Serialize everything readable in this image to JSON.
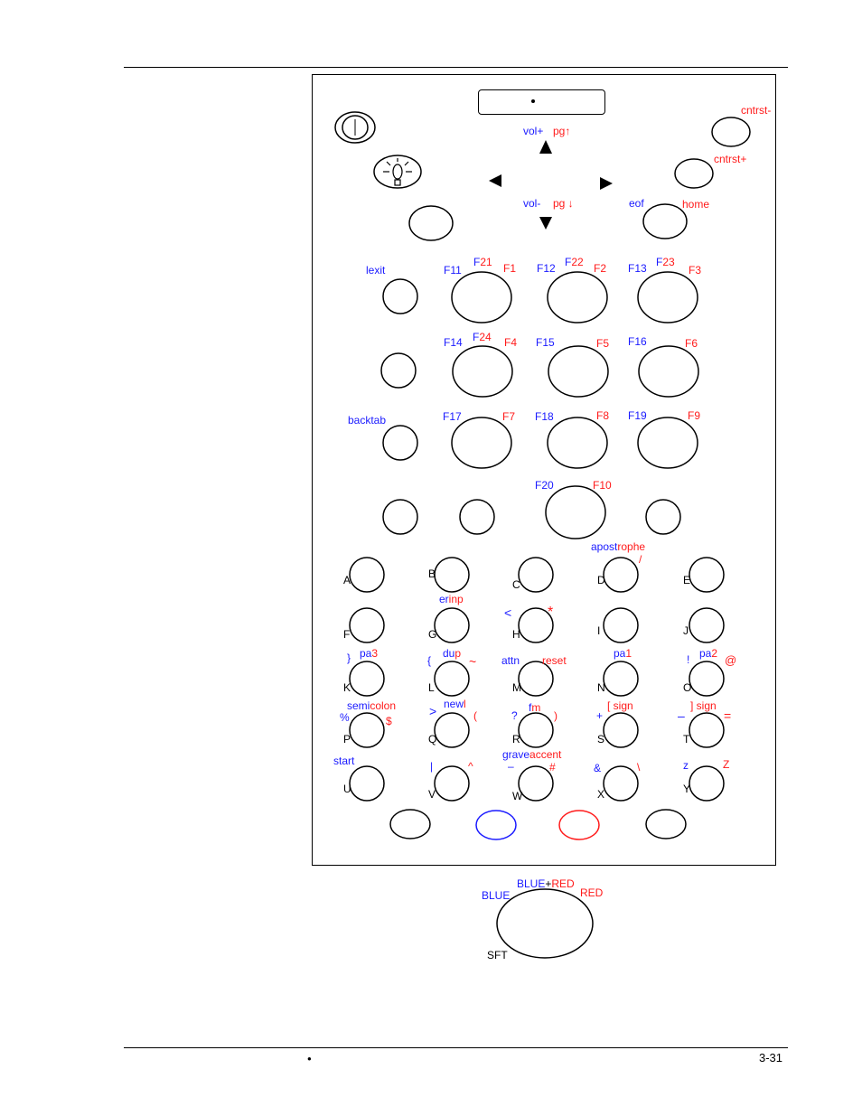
{
  "page": {
    "page_number": "3-31",
    "footer_bullet": "•"
  },
  "keypad": {
    "top": {
      "display_dot": "•",
      "power_icon": "power-icon",
      "backlight_icon": "backlight-icon",
      "vol_up": "vol+",
      "pg_up": "pg↑",
      "vol_down": "vol-",
      "pg_down": "pg ↓",
      "up_arrow": "▲",
      "down_arrow": "▼",
      "left_arrow": "◀",
      "right_arrow": "▶",
      "contrast_minus": "cntrst-",
      "contrast_plus": "cntrst+",
      "eof": "eof",
      "home": "home"
    },
    "function_labels": {
      "lexit": "lexit",
      "backtab": "backtab",
      "f11": "F11",
      "f21_f": "F",
      "f21_n": "21",
      "f1": "F1",
      "f12": "F12",
      "f22_f": "F",
      "f22_n": "22",
      "f2": "F2",
      "f13": "F13",
      "f23_f": "F",
      "f23_n": "23",
      "f3": "F3",
      "f14": "F14",
      "f24_f": "F",
      "f24_n": "24",
      "f4": "F4",
      "f15": "F15",
      "f5": "F5",
      "f16": "F16",
      "f6": "F6",
      "f17": "F17",
      "f7": "F7",
      "f18": "F18",
      "f8": "F8",
      "f19": "F19",
      "f9": "F9",
      "f20": "F20",
      "f10": "F10"
    },
    "letters": [
      "A",
      "B",
      "C",
      "D",
      "E",
      "F",
      "G",
      "H",
      "I",
      "J",
      "K",
      "L",
      "M",
      "N",
      "O",
      "P",
      "Q",
      "R",
      "S",
      "T",
      "U",
      "V",
      "W",
      "X",
      "Y"
    ],
    "alt_labels": {
      "apos_b": "apost",
      "apos_r": "rophe",
      "slash": "/",
      "erinp_b": "er",
      "erinp_r": "inp",
      "lt": "<",
      "star": "*",
      "rbrace": "}",
      "pa3_b": "pa",
      "pa3_r": "3",
      "lbrace": "{",
      "dup_b": "du",
      "dup_r": "p",
      "tilde": "~",
      "attn": "attn",
      "reset": "reset",
      "pa1_b": "pa",
      "pa1_r": "1",
      "excl": "!",
      "pa2_b": "pa",
      "pa2_r": "2",
      "at": "@",
      "semi_b": "semi",
      "semi_r": "colon",
      "percent": "%",
      "dollar": "$",
      "gt": ">",
      "newl_b": "new",
      "newl_r": "l",
      "lparen": "(",
      "question": "?",
      "fm_b": "f",
      "fm_r": "m",
      "rparen": ")",
      "plus": "+",
      "lbracket_sign": "[ sign",
      "minus": "–",
      "rbracket_sign": "] sign",
      "equals": "=",
      "start": "start",
      "pipe": "|",
      "caret": "^",
      "grave_b": "grave",
      "grave_r": "accent",
      "dash": "–",
      "hash": "#",
      "amp": "&",
      "backslash": "\\",
      "z_lower": "z",
      "z_upper": "Z"
    },
    "colors": {
      "blue": "#1a1aff",
      "red": "#ff1a1a"
    }
  },
  "legend": {
    "blue": "BLUE",
    "blue_plus": "BLUE",
    "plus": "+",
    "red_plus": "RED",
    "red": "RED",
    "sft": "SFT"
  }
}
